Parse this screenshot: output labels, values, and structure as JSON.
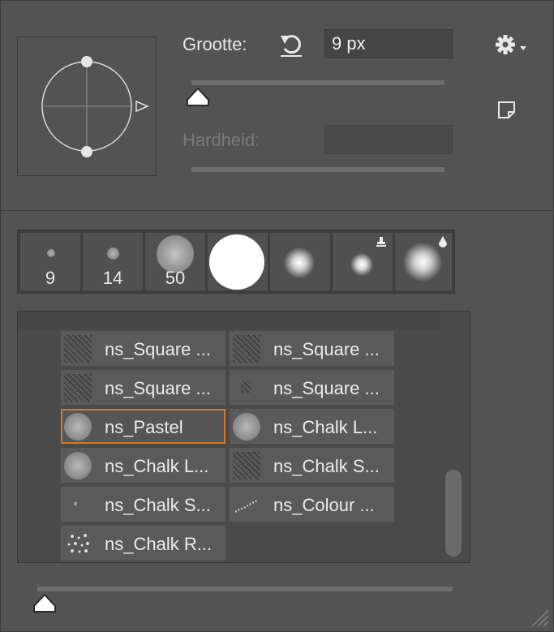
{
  "size": {
    "label": "Grootte:",
    "value": "9 px",
    "level_fraction": 0.02
  },
  "hardness": {
    "label": "Hardheid:",
    "value": "",
    "disabled": true
  },
  "icons": {
    "reset": "reset-icon",
    "settings": "gear-icon",
    "new_preset": "new-preset-icon",
    "resize": "resize-grip-icon"
  },
  "presets": [
    {
      "number": "9",
      "kind": "small-noise"
    },
    {
      "number": "14",
      "kind": "small-noise"
    },
    {
      "number": "50",
      "kind": "large-noise"
    },
    {
      "number": "",
      "kind": "hard-round"
    },
    {
      "number": "",
      "kind": "soft-round"
    },
    {
      "number": "",
      "kind": "soft-round-stamp"
    },
    {
      "number": "",
      "kind": "soft-round-pressure"
    }
  ],
  "brush_list": [
    {
      "name": "ns_Square ...",
      "selected": false
    },
    {
      "name": "ns_Square ...",
      "selected": false
    },
    {
      "name": "ns_Square ...",
      "selected": false
    },
    {
      "name": "ns_Square ...",
      "selected": false
    },
    {
      "name": "ns_Pastel",
      "selected": true
    },
    {
      "name": "ns_Chalk L...",
      "selected": false
    },
    {
      "name": "ns_Chalk L...",
      "selected": false
    },
    {
      "name": "ns_Chalk S...",
      "selected": false
    },
    {
      "name": "ns_Chalk S...",
      "selected": false
    },
    {
      "name": "ns_Colour ...",
      "selected": false
    },
    {
      "name": "ns_Chalk R...",
      "selected": false
    }
  ],
  "thumbnail_size": {
    "level_fraction": 0.02
  },
  "colors": {
    "selection": "#d4792c",
    "panel": "#535353"
  }
}
